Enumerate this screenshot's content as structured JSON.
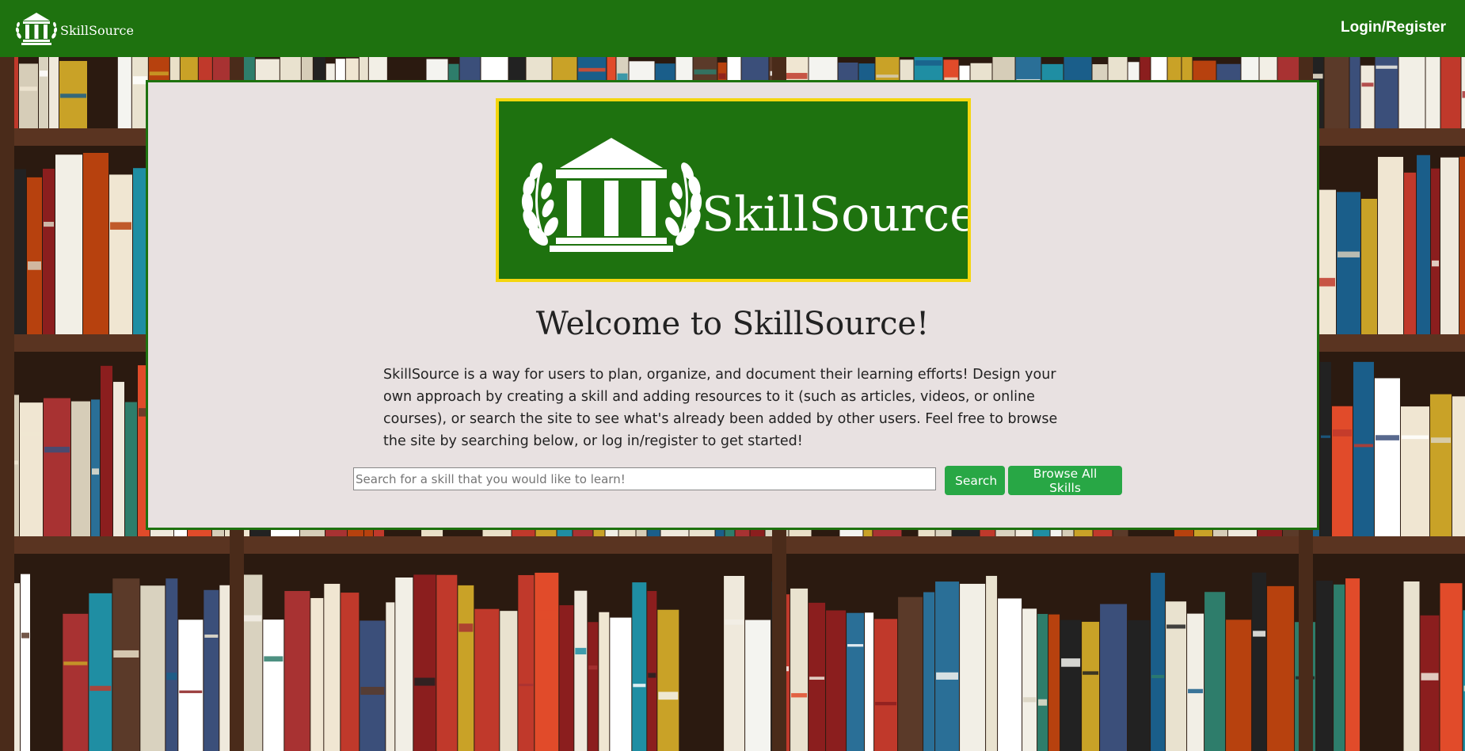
{
  "navbar": {
    "brand_text": "SkillSource",
    "brand_icon": "pillared-building-logo-icon",
    "login_label": "Login/Register",
    "background_color": "#1e720f"
  },
  "hero": {
    "logo_text": "SkillSource",
    "logo_icon": "pillared-building-laurel-logo-icon",
    "logo_background_color": "#1e720f",
    "logo_border_color": "#f4d60e"
  },
  "main": {
    "heading": "Welcome to SkillSource!",
    "intro": "SkillSource is a way for users to plan, organize, and document their learning efforts! Design your own approach by creating a skill and adding resources to it (such as articles, videos, or online courses), or search the site to see what's already been added by other users. Feel free to browse the site by searching below, or log in/register to get started!"
  },
  "search": {
    "placeholder": "Search for a skill that you would like to learn!",
    "value": "",
    "search_button_label": "Search",
    "browse_button_label": "Browse All Skills",
    "button_color": "#28a745"
  },
  "background": {
    "image": "library-bookshelf-photo"
  }
}
